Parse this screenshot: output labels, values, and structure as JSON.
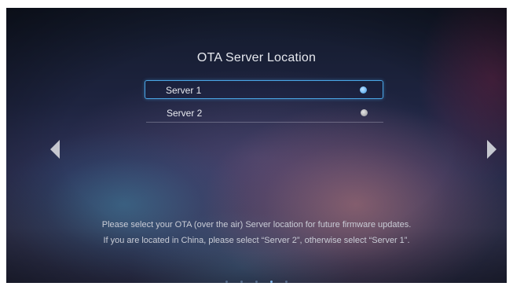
{
  "screen": {
    "title": "OTA Server Location",
    "options": [
      {
        "label": "Server 1",
        "selected": true
      },
      {
        "label": "Server 2",
        "selected": false
      }
    ],
    "description": {
      "line1": "Please select your OTA (over the air) Server location for future firmware updates.",
      "line2": "If you are located in China, please select “Server 2”, otherwise select “Server 1”."
    },
    "pager": {
      "total": 5,
      "current": 4
    }
  },
  "icons": {
    "left": "arrow-left-icon",
    "right": "arrow-right-icon",
    "radio": "radio-icon"
  },
  "colors": {
    "selection_border": "#4aa6e6",
    "radio_selected": "#6fb6f0",
    "radio_unselected": "#a9a9ad",
    "text": "#e8eaf0"
  }
}
